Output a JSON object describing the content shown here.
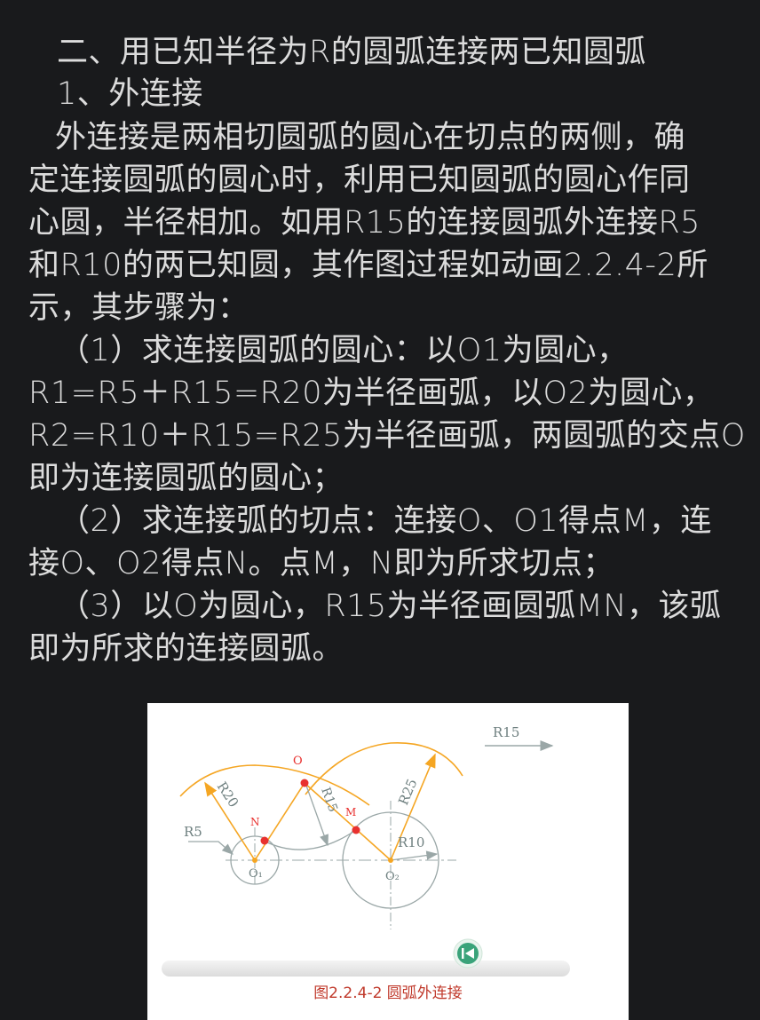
{
  "document": {
    "lines": [
      "二、用已知半径为R的圆弧连接两已知圆弧",
      "1、外连接",
      "外连接是两相切圆弧的圆心在切点的两侧，确",
      "定连接圆弧的圆心时，利用已知圆弧的圆心作同",
      "心圆，半径相加。如用R15的连接圆弧外连接R5",
      "和R10的两已知圆，其作图过程如动画2.2.4-2所",
      "示，其步骤为：",
      "（1）求连接圆弧的圆心：以O1为圆心，",
      "R1=R5＋R15=R20为半径画弧，以O2为圆心，",
      "R2=R10＋R15=R25为半径画弧，两圆弧的交点O",
      "即为连接圆弧的圆心；",
      "（2）求连接弧的切点：连接O、O1得点M，连",
      "接O、O2得点N。点M，N即为所求切点；",
      "（3）以O为圆心，R15为半径画圆弧MN，该弧",
      "即为所求的连接圆弧。"
    ]
  },
  "figure": {
    "labels": {
      "r15": "R15",
      "o": "O",
      "r20": "R20",
      "r15_diag": "R15",
      "r25": "R25",
      "r5": "R5",
      "n": "N",
      "m": "M",
      "r10": "R10",
      "o1": "O₁",
      "o2": "O₂"
    },
    "caption": "图2.2.4-2  圆弧外连接"
  },
  "colors": {
    "text": "#dcdcdc",
    "background": "#191a1c",
    "orange": "#f5a623",
    "gray_line": "#9aa7a7",
    "red_dot": "#e8312f",
    "caption": "#c0392b",
    "button": "#3aa37a"
  }
}
